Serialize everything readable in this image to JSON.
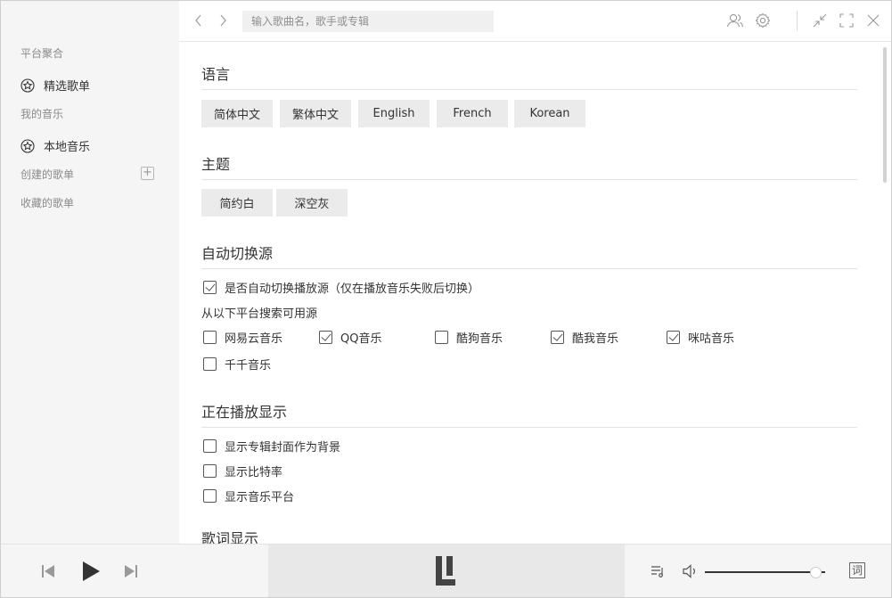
{
  "sidebar": {
    "group_platform": "平台聚合",
    "item_featured": "精选歌单",
    "group_my_music": "我的音乐",
    "item_local": "本地音乐",
    "group_created": "创建的歌单",
    "group_collected": "收藏的歌单"
  },
  "topbar": {
    "search_placeholder": "输入歌曲名，歌手或专辑"
  },
  "settings": {
    "language": {
      "title": "语言",
      "options": [
        "简体中文",
        "繁体中文",
        "English",
        "French",
        "Korean"
      ]
    },
    "theme": {
      "title": "主题",
      "options": [
        "简约白",
        "深空灰"
      ]
    },
    "auto_switch": {
      "title": "自动切换源",
      "toggle_label": "是否自动切换播放源（仅在播放音乐失败后切换）",
      "toggle_checked": true,
      "sources_label": "从以下平台搜索可用源",
      "sources": [
        {
          "label": "网易云音乐",
          "checked": false
        },
        {
          "label": "QQ音乐",
          "checked": true
        },
        {
          "label": "酷狗音乐",
          "checked": false
        },
        {
          "label": "酷我音乐",
          "checked": true
        },
        {
          "label": "咪咕音乐",
          "checked": true
        },
        {
          "label": "千千音乐",
          "checked": false
        }
      ]
    },
    "now_playing": {
      "title": "正在播放显示",
      "options": [
        {
          "label": "显示专辑封面作为背景",
          "checked": false
        },
        {
          "label": "显示比特率",
          "checked": false
        },
        {
          "label": "显示音乐平台",
          "checked": false
        }
      ]
    },
    "lyrics": {
      "title": "歌词显示"
    }
  },
  "player": {
    "volume": 0.92,
    "lyric_button": "词"
  },
  "colors": {
    "sidebar_bg": "#f5f5f5",
    "pill_bg": "#ebebeb",
    "now_playing_bg": "#e8e8e8",
    "icon_gray": "#999999"
  }
}
